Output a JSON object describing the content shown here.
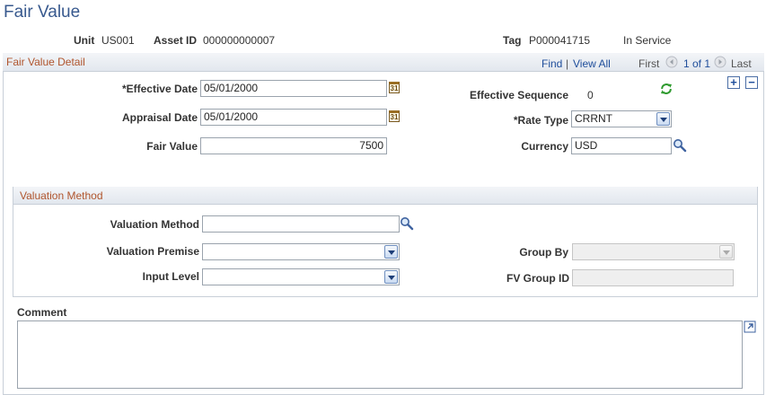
{
  "page": {
    "title": "Fair Value"
  },
  "keys": {
    "unit_label": "Unit",
    "unit_value": "US001",
    "asset_id_label": "Asset ID",
    "asset_id_value": "000000000007",
    "tag_label": "Tag",
    "tag_value": "P000041715",
    "status": "In Service"
  },
  "detail": {
    "title": "Fair Value Detail",
    "find": "Find",
    "separator": "|",
    "view_all": "View All",
    "first": "First",
    "range": "1 of 1",
    "last": "Last",
    "effective_date_label": "*Effective Date",
    "effective_date_value": "05/01/2000",
    "effective_sequence_label": "Effective Sequence",
    "effective_sequence_value": "0",
    "appraisal_date_label": "Appraisal Date",
    "appraisal_date_value": "05/01/2000",
    "rate_type_label": "*Rate Type",
    "rate_type_value": "CRRNT",
    "fair_value_label": "Fair Value",
    "fair_value_value": "7500",
    "currency_label": "Currency",
    "currency_value": "USD",
    "add_symbol": "+",
    "remove_symbol": "−",
    "calendar_glyph": "31"
  },
  "valuation": {
    "title": "Valuation Method",
    "method_label": "Valuation Method",
    "method_value": "",
    "premise_label": "Valuation Premise",
    "premise_value": "",
    "input_level_label": "Input Level",
    "input_level_value": "",
    "group_by_label": "Group By",
    "group_by_value": "",
    "fv_group_id_label": "FV Group ID",
    "fv_group_id_value": ""
  },
  "comment": {
    "label": "Comment",
    "value": ""
  }
}
